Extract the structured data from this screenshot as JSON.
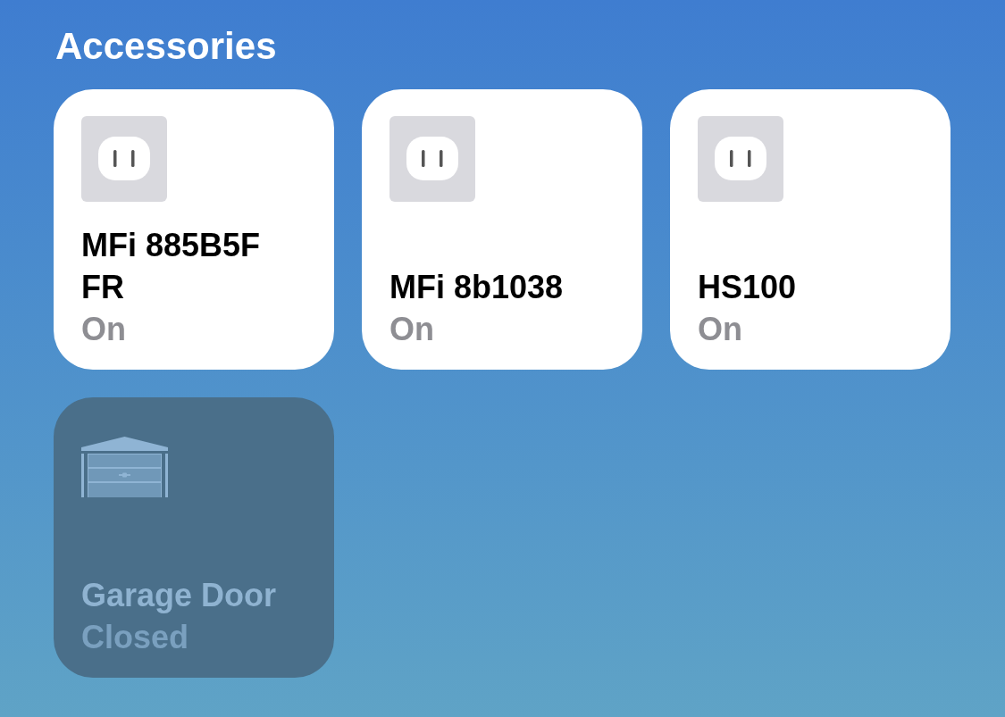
{
  "section_title": "Accessories",
  "accessories": [
    {
      "kind": "outlet",
      "name": "MFi 885B5F FR",
      "status": "On",
      "on": true
    },
    {
      "kind": "outlet",
      "name": "MFi 8b1038",
      "status": "On",
      "on": true
    },
    {
      "kind": "outlet",
      "name": "HS100",
      "status": "On",
      "on": true
    },
    {
      "kind": "garage-door",
      "name": "Garage Door",
      "status": "Closed",
      "on": false
    }
  ]
}
